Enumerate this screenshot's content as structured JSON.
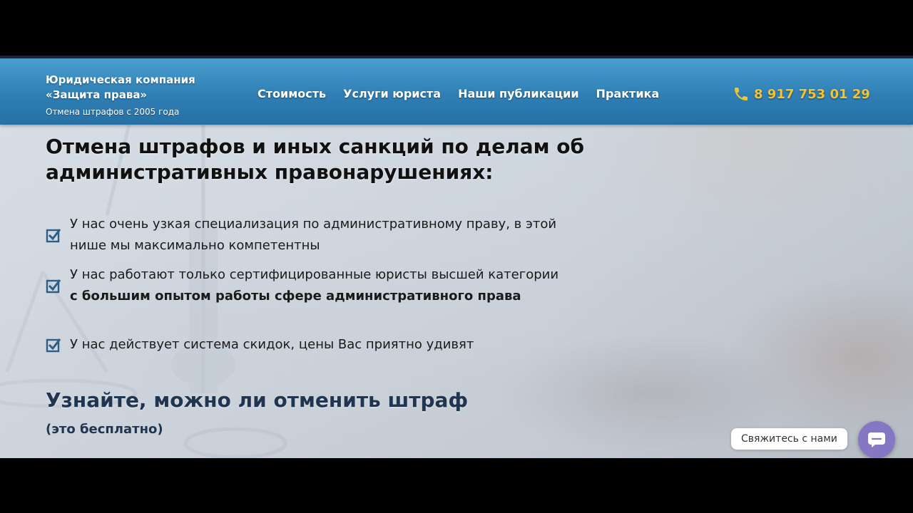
{
  "header": {
    "brand_name": "Юридическая компания «Защита права»",
    "brand_tagline": "Отмена штрафов с 2005 года",
    "nav": [
      "Стоимость",
      "Услуги юриста",
      "Наши публикации",
      "Практика"
    ],
    "phone": "8 917 753 01 29"
  },
  "hero": {
    "title": "Отмена штрафов и иных санкций по делам об административных правонарушениях:",
    "features": [
      {
        "text": "У нас очень узкая специализация по административному праву, в этой нише мы максимально компетентны"
      },
      {
        "text_pre": "У нас работают только сертифицированные юристы высшей категории ",
        "text_bold": "с большим опытом работы сфере административного права"
      },
      {
        "text": "У нас действует система скидок, цены Вас приятно удивят"
      }
    ],
    "cta_title": "Узнайте, можно ли отменить штраф",
    "cta_subtitle": "(это бесплатно)"
  },
  "widget": {
    "contact_label": "Свяжитесь с нами"
  },
  "colors": {
    "header_blue": "#2f7fb5",
    "phone_yellow": "#f5c330",
    "cta_navy": "#1f3550",
    "widget_purple": "#8577c4"
  },
  "icons": [
    "phone-icon",
    "checkbox-icon",
    "chat-icon"
  ]
}
